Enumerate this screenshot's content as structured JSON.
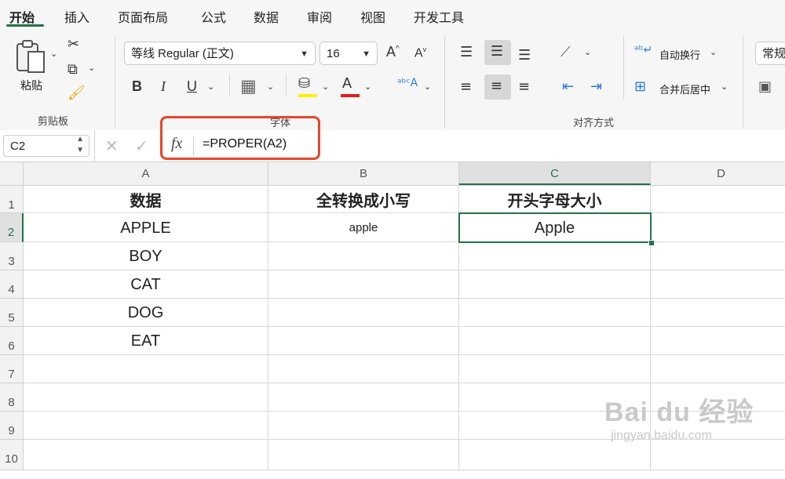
{
  "tabs": [
    "开始",
    "插入",
    "页面布局",
    "公式",
    "数据",
    "审阅",
    "视图",
    "开发工具"
  ],
  "ribbon": {
    "clipboard": {
      "paste_label": "粘贴",
      "group_label": "剪贴板"
    },
    "font": {
      "font_name": "等线 Regular (正文)",
      "font_size": "16",
      "group_label": "字体",
      "bold": "B",
      "italic": "I",
      "underline": "U",
      "grow": "A",
      "shrink": "A",
      "font_color_glyph": "A",
      "fill_color": "#ffef00",
      "font_color": "#e31c1c"
    },
    "alignment": {
      "wrap_text": "自动换行",
      "merge_center": "合并后居中",
      "group_label": "对齐方式"
    },
    "number": {
      "format": "常规"
    }
  },
  "formula_bar": {
    "name_box": "C2",
    "fx": "fx",
    "formula": "=PROPER(A2)"
  },
  "sheet": {
    "columns": [
      "A",
      "B",
      "C",
      "D"
    ],
    "rows": [
      "1",
      "2",
      "3",
      "4",
      "5",
      "6",
      "7",
      "8",
      "9",
      "10"
    ],
    "header_row": [
      "数据",
      "全转换成小写",
      "开头字母大小"
    ],
    "col_a_values": [
      "APPLE",
      "BOY",
      "CAT",
      "DOG",
      "EAT"
    ],
    "b2": "apple",
    "c2": "Apple"
  },
  "watermark": {
    "brand": "Bai du 经验",
    "url": "jingyan.baidu.com"
  }
}
